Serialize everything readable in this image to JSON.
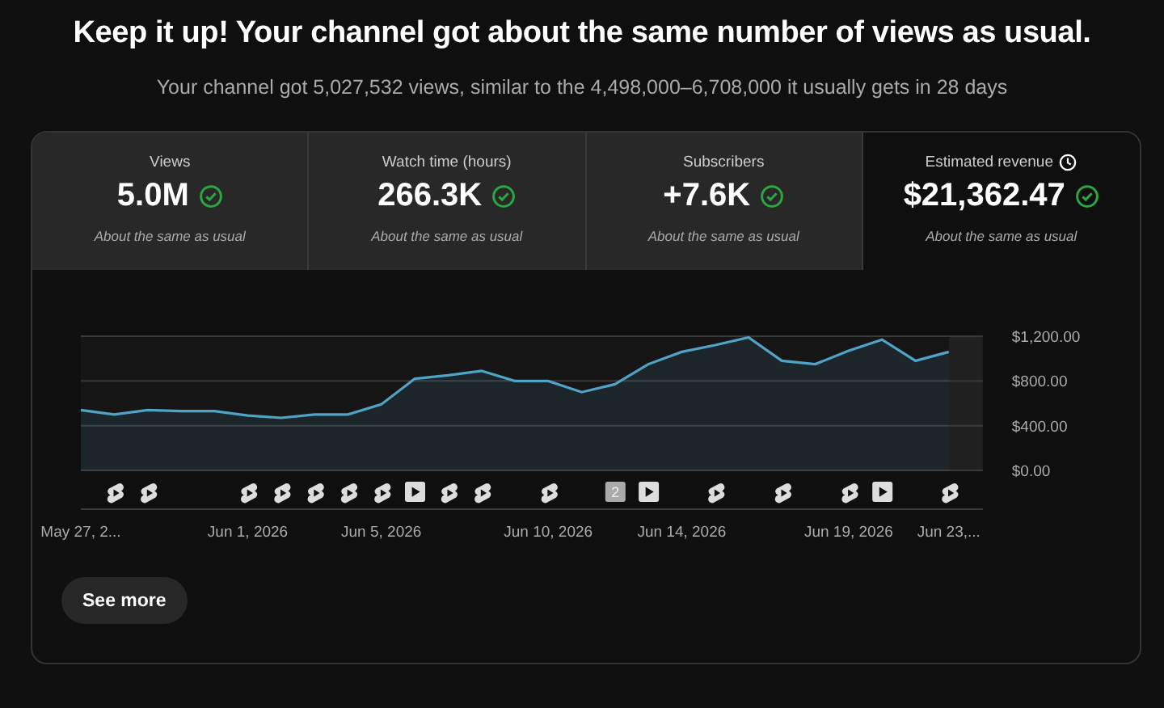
{
  "headline": "Keep it up! Your channel got about the same number of views as usual.",
  "summary": "Your channel got 5,027,532 views, similar to the 4,498,000–6,708,000 it usually gets in 28 days",
  "metrics": [
    {
      "label": "Views",
      "value": "5.0M",
      "note": "About the same as usual",
      "selected": false,
      "clock_icon": false
    },
    {
      "label": "Watch time (hours)",
      "value": "266.3K",
      "note": "About the same as usual",
      "selected": false,
      "clock_icon": false
    },
    {
      "label": "Subscribers",
      "value": "+7.6K",
      "note": "About the same as usual",
      "selected": false,
      "clock_icon": false
    },
    {
      "label": "Estimated revenue",
      "value": "$21,362.47",
      "note": "About the same as usual",
      "selected": true,
      "clock_icon": true
    }
  ],
  "chart": {
    "chart_data": {
      "type": "area",
      "categories": [
        "May 27, 2...",
        null,
        null,
        null,
        null,
        "Jun 1, 2026",
        null,
        null,
        null,
        "Jun 5, 2026",
        null,
        null,
        null,
        null,
        "Jun 10, 2026",
        null,
        null,
        null,
        "Jun 14, 2026",
        null,
        null,
        null,
        null,
        "Jun 19, 2026",
        null,
        null,
        "Jun 23,..."
      ],
      "series": [
        {
          "color": "#4fa3c7",
          "values": [
            540,
            500,
            540,
            530,
            530,
            490,
            470,
            500,
            500,
            590,
            820,
            850,
            890,
            800,
            800,
            700,
            770,
            950,
            1060,
            1120,
            1190,
            980,
            950,
            1070,
            1170,
            980,
            1060
          ]
        }
      ],
      "ylim": [
        0,
        1200
      ],
      "yticks": [
        {
          "value": 0,
          "label": "$0.00"
        },
        {
          "value": 400,
          "label": "$400.00"
        },
        {
          "value": 800,
          "label": "$800.00"
        },
        {
          "value": 1200,
          "label": "$1,200.00"
        }
      ]
    },
    "markers": [
      {
        "kind": "none"
      },
      {
        "kind": "short"
      },
      {
        "kind": "short"
      },
      {
        "kind": "none"
      },
      {
        "kind": "none"
      },
      {
        "kind": "short"
      },
      {
        "kind": "short"
      },
      {
        "kind": "short"
      },
      {
        "kind": "short"
      },
      {
        "kind": "short"
      },
      {
        "kind": "video"
      },
      {
        "kind": "short"
      },
      {
        "kind": "short"
      },
      {
        "kind": "none"
      },
      {
        "kind": "short"
      },
      {
        "kind": "none"
      },
      {
        "kind": "count",
        "label": "2"
      },
      {
        "kind": "video"
      },
      {
        "kind": "none"
      },
      {
        "kind": "short"
      },
      {
        "kind": "none"
      },
      {
        "kind": "short"
      },
      {
        "kind": "none"
      },
      {
        "kind": "short"
      },
      {
        "kind": "video"
      },
      {
        "kind": "none"
      },
      {
        "kind": "short"
      }
    ]
  },
  "see_more": "See more"
}
